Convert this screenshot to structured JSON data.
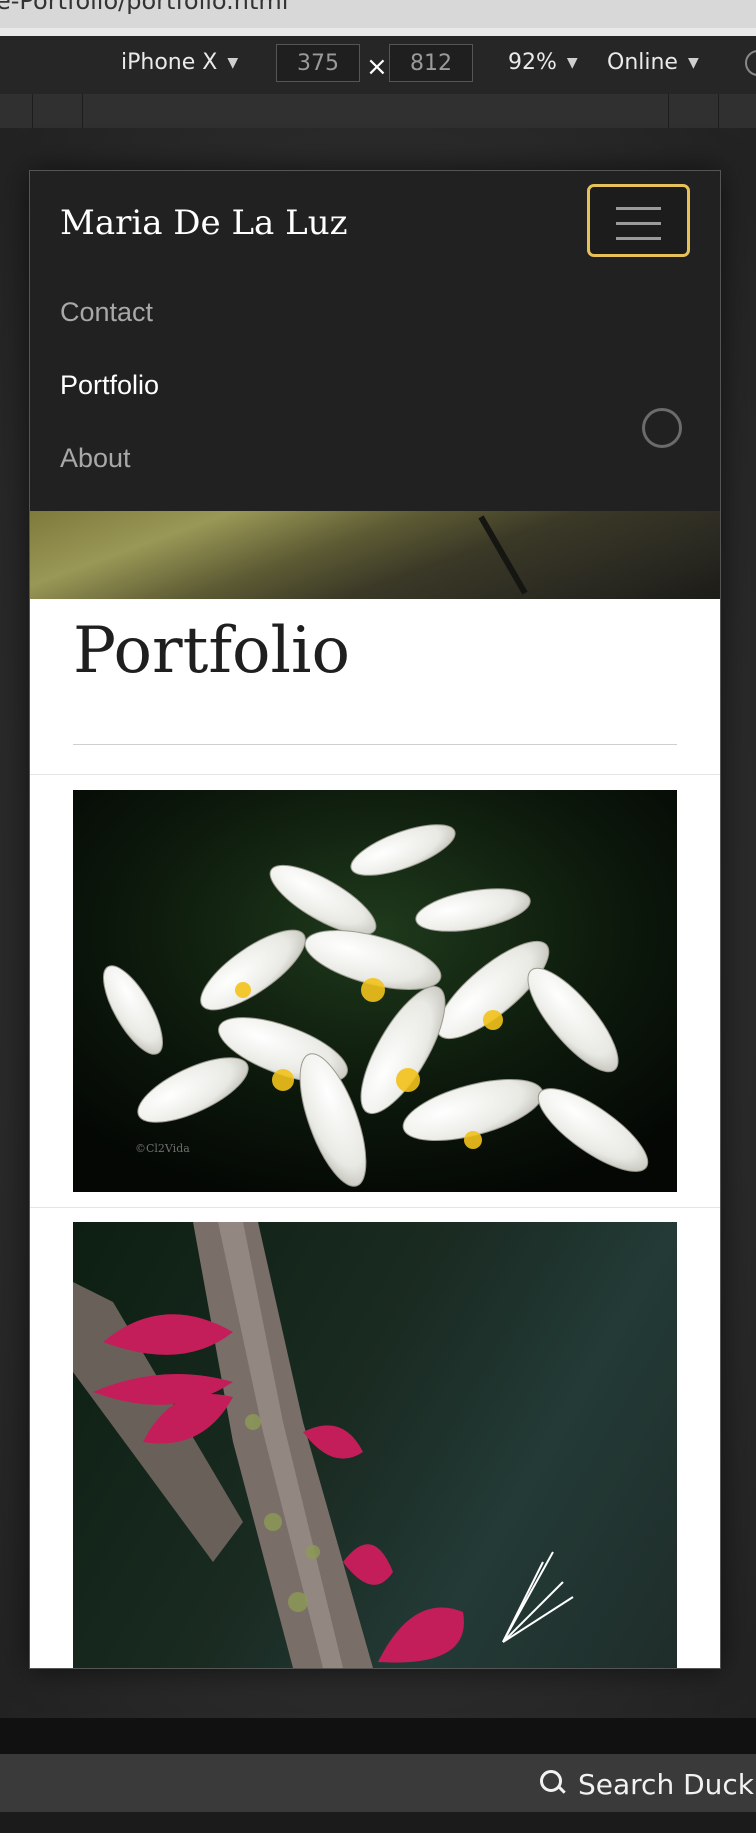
{
  "browser": {
    "url_fragment": "e-Portfolio/portfolio.html"
  },
  "device_toolbar": {
    "device": "iPhone X",
    "width": "375",
    "height": "812",
    "zoom": "92%",
    "network": "Online",
    "times": "×"
  },
  "site": {
    "brand": "Maria De La Luz",
    "nav": {
      "contact": "Contact",
      "portfolio": "Portfolio",
      "about": "About"
    },
    "page_title": "Portfolio",
    "watermark": "©Cl2Vida"
  },
  "bottom_bar": {
    "search_label": "Search Duck"
  },
  "colors": {
    "nav_bg": "#212121",
    "toggler_border": "#e6c15a",
    "page_bg": "#ffffff"
  }
}
